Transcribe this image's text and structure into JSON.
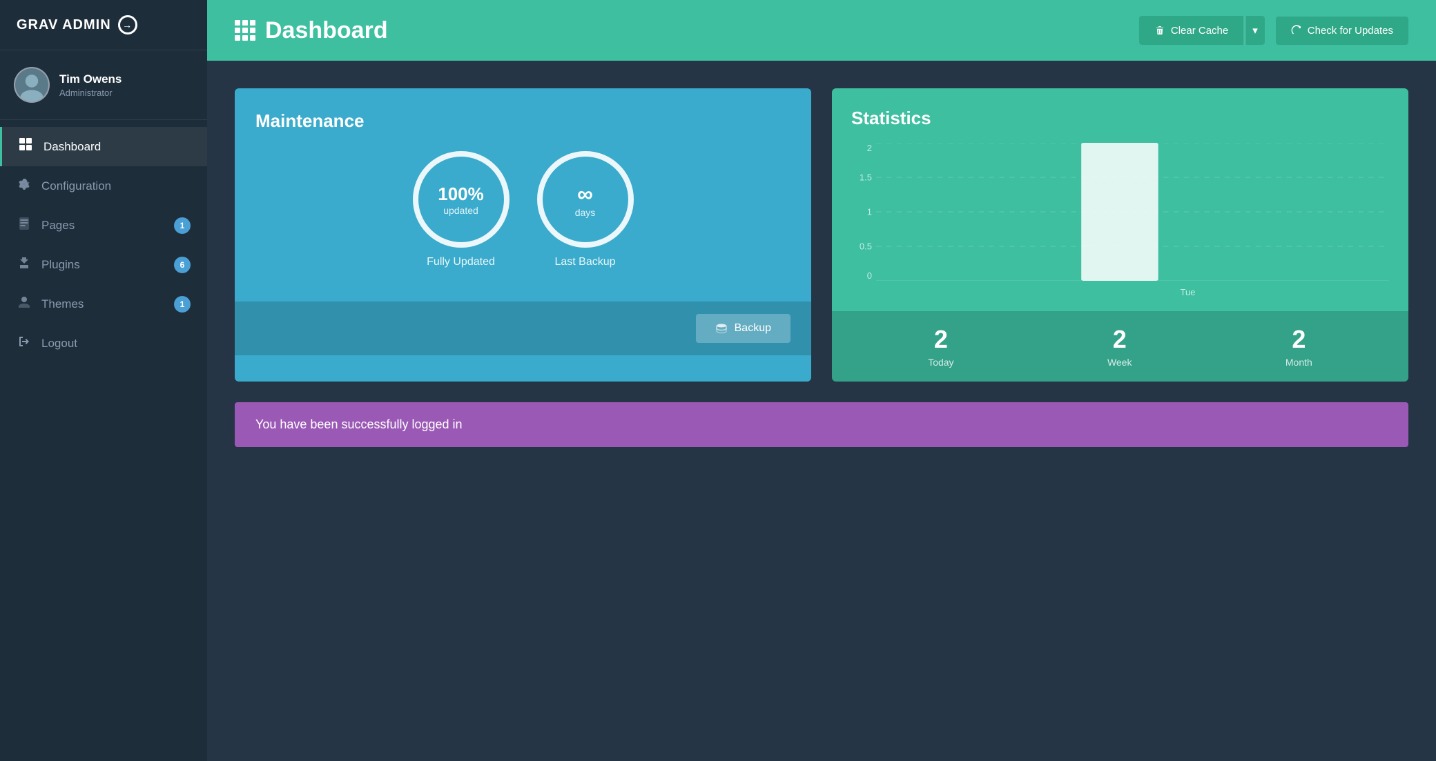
{
  "brand": {
    "title": "GRAV ADMIN",
    "icon_symbol": "→"
  },
  "user": {
    "name": "Tim Owens",
    "role": "Administrator",
    "avatar_symbol": "👤"
  },
  "sidebar": {
    "items": [
      {
        "id": "dashboard",
        "label": "Dashboard",
        "icon": "⊞",
        "badge": null,
        "active": true
      },
      {
        "id": "configuration",
        "label": "Configuration",
        "icon": "🔧",
        "badge": null,
        "active": false
      },
      {
        "id": "pages",
        "label": "Pages",
        "icon": "📄",
        "badge": "1",
        "active": false
      },
      {
        "id": "plugins",
        "label": "Plugins",
        "icon": "🔌",
        "badge": "6",
        "active": false
      },
      {
        "id": "themes",
        "label": "Themes",
        "icon": "💧",
        "badge": "1",
        "active": false
      },
      {
        "id": "logout",
        "label": "Logout",
        "icon": "⎋",
        "badge": null,
        "active": false
      }
    ]
  },
  "header": {
    "title": "Dashboard",
    "clear_cache_label": "Clear Cache",
    "clear_cache_dropdown": "▾",
    "check_updates_label": "Check for Updates"
  },
  "maintenance": {
    "title": "Maintenance",
    "updated_value": "100%",
    "updated_label": "updated",
    "updated_caption": "Fully Updated",
    "backup_value": "∞",
    "backup_label": "days",
    "backup_caption": "Last Backup",
    "backup_button": "Backup"
  },
  "statistics": {
    "title": "Statistics",
    "chart": {
      "y_labels": [
        "2",
        "1.5",
        "1",
        "0.5",
        "0"
      ],
      "x_label": "Tue",
      "bar_height_pct": 100
    },
    "today_value": "2",
    "today_label": "Today",
    "week_value": "2",
    "week_label": "Week",
    "month_value": "2",
    "month_label": "Month"
  },
  "success_banner": {
    "message": "You have been successfully logged in"
  }
}
